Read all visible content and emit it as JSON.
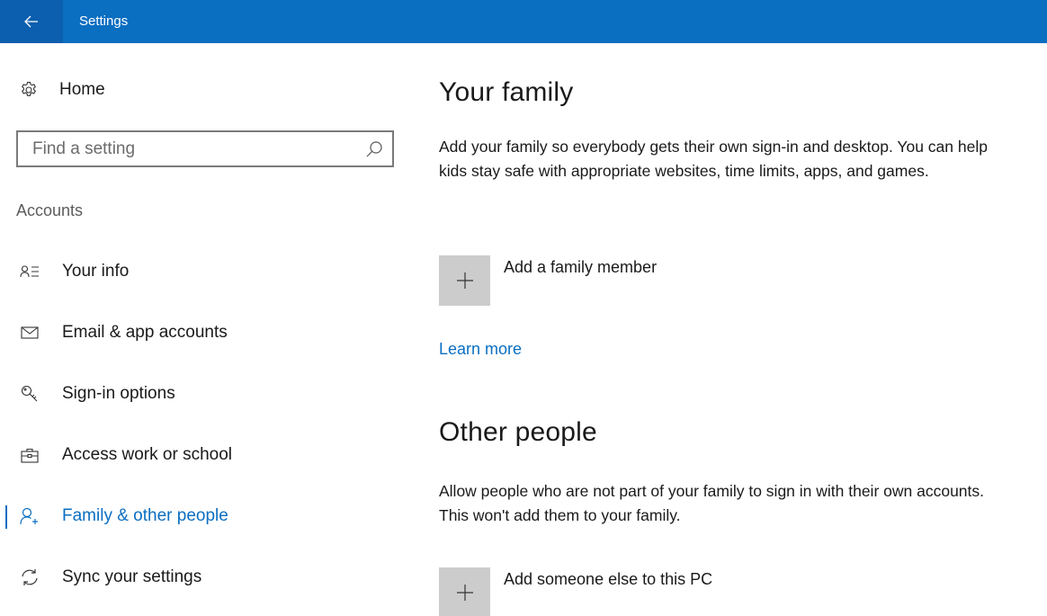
{
  "window": {
    "title": "Settings"
  },
  "sidebar": {
    "home_label": "Home",
    "search_placeholder": "Find a setting",
    "section_title": "Accounts",
    "items": [
      {
        "label": "Your info",
        "icon": "your-info-icon"
      },
      {
        "label": "Email & app accounts",
        "icon": "mail-icon"
      },
      {
        "label": "Sign-in options",
        "icon": "key-icon"
      },
      {
        "label": "Access work or school",
        "icon": "briefcase-icon"
      },
      {
        "label": "Family & other people",
        "icon": "add-person-icon",
        "active": true
      },
      {
        "label": "Sync your settings",
        "icon": "sync-icon"
      }
    ]
  },
  "main": {
    "family": {
      "heading": "Your family",
      "description": "Add your family so everybody gets their own sign-in and desktop. You can help kids stay safe with appropriate websites, time limits, apps, and games.",
      "add_label": "Add a family member",
      "learn_more": "Learn more"
    },
    "other": {
      "heading": "Other people",
      "description": "Allow people who are not part of your family to sign in with their own accounts. This won't add them to your family.",
      "add_label": "Add someone else to this PC"
    }
  },
  "colors": {
    "accent": "#0a6ec1",
    "titlebar": "#0a6ec1",
    "back_button": "#0b5fae",
    "add_tile": "#cccccc"
  }
}
